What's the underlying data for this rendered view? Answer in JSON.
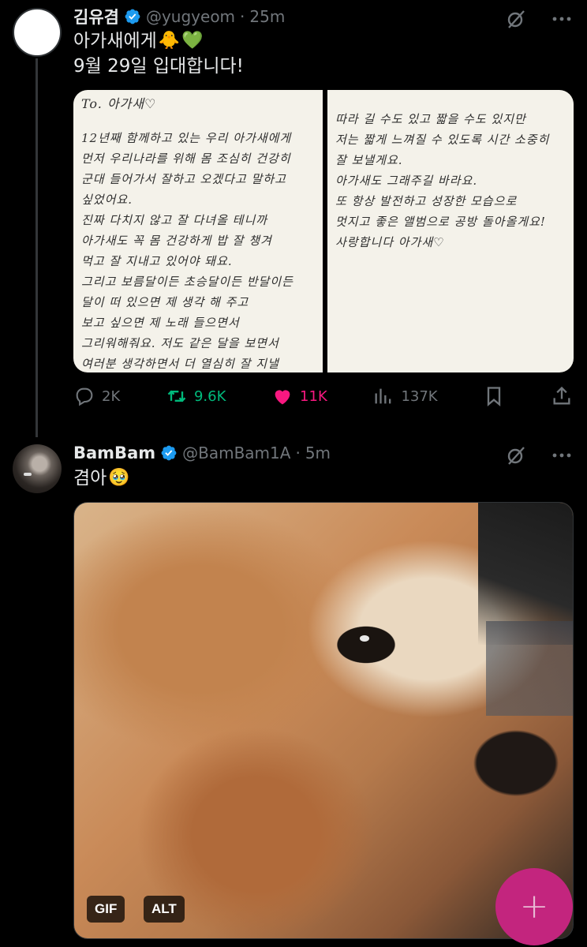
{
  "tweets": [
    {
      "author": {
        "name": "김유겸",
        "handle": "@yugyeom",
        "time": "25m",
        "verified": true
      },
      "text_lines": [
        "아가새에게",
        "9월 29일 입대합니다!"
      ],
      "emojis": [
        "🐥",
        "💚"
      ],
      "letter_pages": {
        "left": {
          "header": "To. 아가새♡",
          "lines": [
            "12년째 함께하고 있는 우리 아가새에게",
            "먼저 우리나라를 위해 몸 조심히 건강히",
            "군대 들어가서 잘하고 오겠다고 말하고",
            "싶었어요.",
            "진짜 다치지 않고 잘 다녀올 테니까",
            "아가새도 꼭 몸 건강하게 밥 잘 챙겨",
            "먹고 잘 지내고 있어야 돼요.",
            "그리고 보름달이든 초승달이든 반달이든",
            "달이 떠 있으면 제 생각 해 주고",
            "보고 싶으면 제 노래 들으면서",
            "그리워해줘요. 저도 같은 달을 보면서",
            "여러분 생각하면서 더 열심히 잘 지낼"
          ]
        },
        "right": {
          "lines": [
            "따라 길 수도 있고 짧을 수도 있지만",
            "저는 짧게 느껴질 수 있도록 시간 소중히",
            "잘 보낼게요.",
            "아가새도 그래주길 바라요.",
            "또 항상 발전하고 성장한 모습으로",
            "멋지고 좋은 앨범으로 공방 돌아올게요!",
            "사랑합니다 아가새♡"
          ]
        }
      },
      "actions": {
        "replies": "2K",
        "retweets": "9.6K",
        "likes": "11K",
        "views": "137K"
      }
    },
    {
      "author": {
        "name": "BamBam",
        "handle": "@BamBam1A",
        "time": "5m",
        "verified": true
      },
      "text": "겸아",
      "emoji": "🥹",
      "media_badges": {
        "gif": "GIF",
        "alt": "ALT"
      }
    }
  ],
  "dot": "·",
  "fab": {
    "icon": "plus-icon",
    "symbol": "+"
  },
  "colors": {
    "retweet": "#00ba7c",
    "like": "#f91880",
    "verified": "#1d9bf0",
    "fab": "#c3257e"
  }
}
